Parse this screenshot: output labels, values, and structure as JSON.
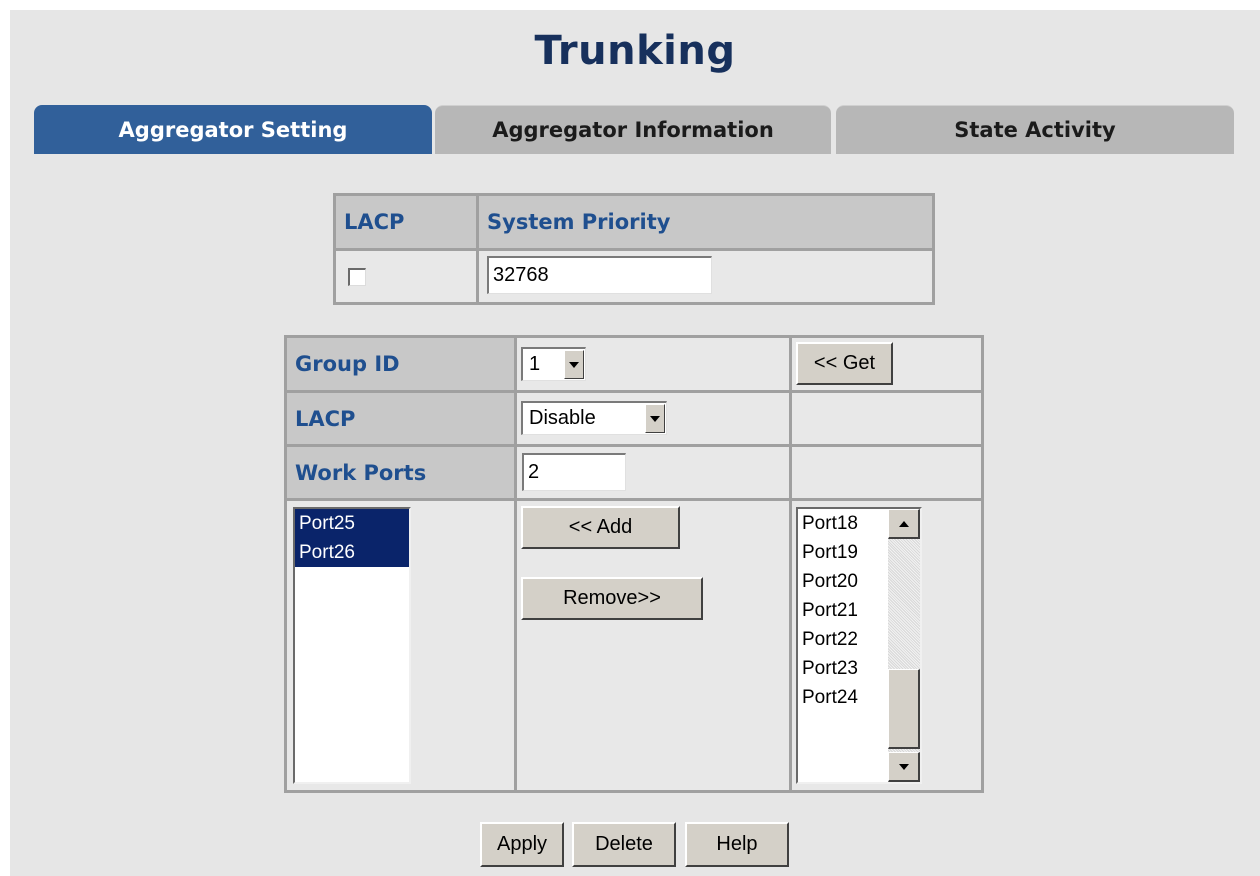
{
  "page": {
    "title": "Trunking"
  },
  "tabs": [
    {
      "label": "Aggregator Setting",
      "active": true
    },
    {
      "label": "Aggregator Information",
      "active": false
    },
    {
      "label": "State Activity",
      "active": false
    }
  ],
  "system": {
    "lacp_header": "LACP",
    "priority_header": "System Priority",
    "lacp_checked": false,
    "priority_value": "32768"
  },
  "group": {
    "group_id_label": "Group ID",
    "group_id_value": "1",
    "get_button": "<< Get",
    "lacp_label": "LACP",
    "lacp_value": "Disable",
    "work_ports_label": "Work Ports",
    "work_ports_value": "2",
    "add_button": "<< Add",
    "remove_button": "Remove>>",
    "member_ports": [
      {
        "label": "Port25",
        "selected": true
      },
      {
        "label": "Port26",
        "selected": true
      }
    ],
    "available_ports": [
      "Port18",
      "Port19",
      "Port20",
      "Port21",
      "Port22",
      "Port23",
      "Port24"
    ]
  },
  "actions": {
    "apply": "Apply",
    "delete": "Delete",
    "help": "Help"
  },
  "colors": {
    "title": "#17305c",
    "active_tab": "#31609a",
    "label": "#1f4f8f",
    "selection": "#0a246a"
  }
}
